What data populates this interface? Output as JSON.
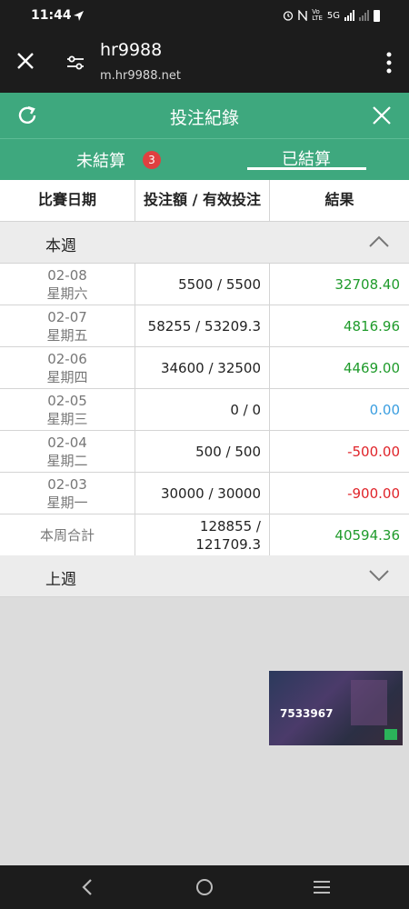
{
  "status_bar": {
    "time": "11:44",
    "network": "5G"
  },
  "browser": {
    "site_title": "hr9988",
    "url": "m.hr9988.net"
  },
  "header": {
    "title": "投注紀錄"
  },
  "tabs": [
    {
      "label": "未結算",
      "badge": "3"
    },
    {
      "label": "已結算",
      "active": true
    }
  ],
  "table": {
    "columns": [
      "比賽日期",
      "投注額 / 有效投注",
      "結果"
    ],
    "this_week": {
      "label": "本週",
      "rows": [
        {
          "date": "02-08",
          "day": "星期六",
          "bet": "5500 / 5500",
          "result": "32708.40",
          "status": "positive"
        },
        {
          "date": "02-07",
          "day": "星期五",
          "bet": "58255 / 53209.3",
          "result": "4816.96",
          "status": "positive"
        },
        {
          "date": "02-06",
          "day": "星期四",
          "bet": "34600 / 32500",
          "result": "4469.00",
          "status": "positive"
        },
        {
          "date": "02-05",
          "day": "星期三",
          "bet": "0 / 0",
          "result": "0.00",
          "status": "zero"
        },
        {
          "date": "02-04",
          "day": "星期二",
          "bet": "500 / 500",
          "result": "-500.00",
          "status": "negative"
        },
        {
          "date": "02-03",
          "day": "星期一",
          "bet": "30000 / 30000",
          "result": "-900.00",
          "status": "negative"
        }
      ],
      "total": {
        "label": "本周合計",
        "bet_line1": "128855 /",
        "bet_line2": "121709.3",
        "result": "40594.36"
      }
    },
    "last_week": {
      "label": "上週"
    }
  },
  "video_overlay": {
    "number": "7533967"
  },
  "colors": {
    "accent": "#3ea87e",
    "positive": "#1f9b2b",
    "negative": "#e0242a",
    "zero": "#3a9ee0",
    "badge": "#e04040"
  }
}
